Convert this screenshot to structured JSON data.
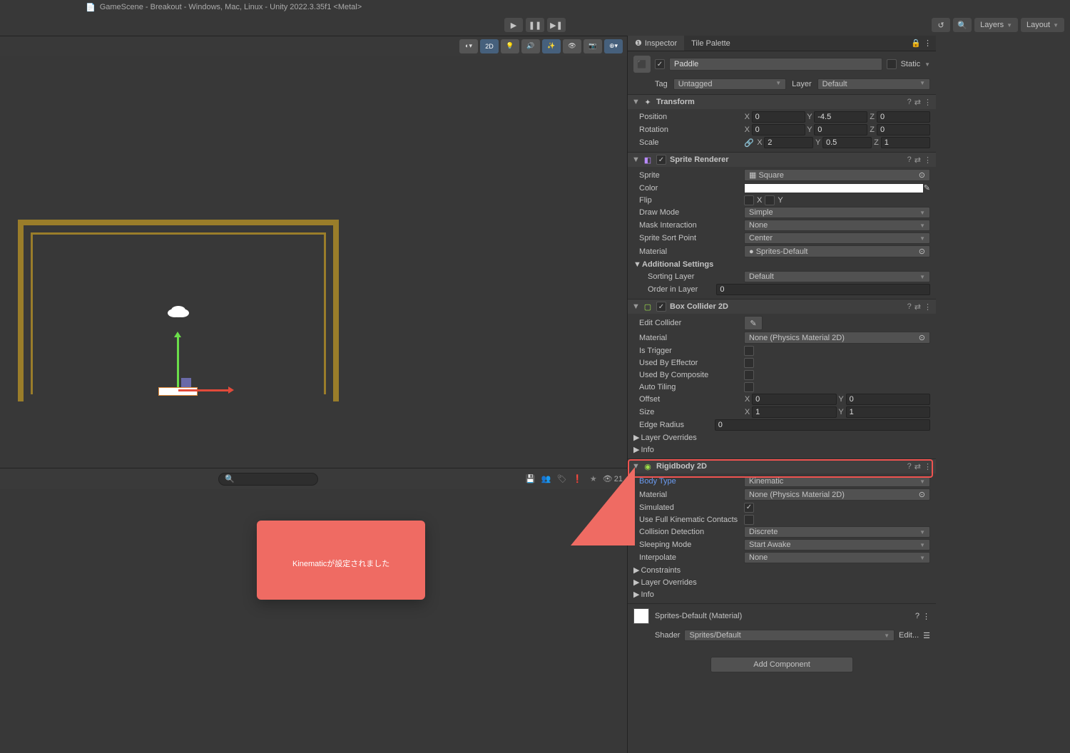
{
  "window_title": "GameScene - Breakout - Windows, Mac, Linux - Unity 2022.3.35f1 <Metal>",
  "toolbar": {
    "layers": "Layers",
    "layout": "Layout"
  },
  "tabs": {
    "inspector": "Inspector",
    "tile_palette": "Tile Palette"
  },
  "scene_tools": {
    "mode_2d": "2D"
  },
  "object": {
    "name": "Paddle",
    "static_label": "Static",
    "tag_label": "Tag",
    "tag_value": "Untagged",
    "layer_label": "Layer",
    "layer_value": "Default"
  },
  "transform": {
    "title": "Transform",
    "position_label": "Position",
    "rotation_label": "Rotation",
    "scale_label": "Scale",
    "position": {
      "x": "0",
      "y": "-4.5",
      "z": "0"
    },
    "rotation": {
      "x": "0",
      "y": "0",
      "z": "0"
    },
    "scale": {
      "x": "2",
      "y": "0.5",
      "z": "1"
    }
  },
  "sprite_renderer": {
    "title": "Sprite Renderer",
    "sprite_label": "Sprite",
    "sprite_value": "Square",
    "color_label": "Color",
    "flip_label": "Flip",
    "draw_mode_label": "Draw Mode",
    "draw_mode_value": "Simple",
    "mask_label": "Mask Interaction",
    "mask_value": "None",
    "sort_point_label": "Sprite Sort Point",
    "sort_point_value": "Center",
    "material_label": "Material",
    "material_value": "Sprites-Default",
    "additional_label": "Additional Settings",
    "sorting_layer_label": "Sorting Layer",
    "sorting_layer_value": "Default",
    "order_label": "Order in Layer",
    "order_value": "0"
  },
  "box_collider": {
    "title": "Box Collider 2D",
    "edit_label": "Edit Collider",
    "material_label": "Material",
    "material_value": "None (Physics Material 2D)",
    "is_trigger_label": "Is Trigger",
    "used_effector_label": "Used By Effector",
    "used_composite_label": "Used By Composite",
    "auto_tiling_label": "Auto Tiling",
    "offset_label": "Offset",
    "offset": {
      "x": "0",
      "y": "0"
    },
    "size_label": "Size",
    "size": {
      "x": "1",
      "y": "1"
    },
    "edge_radius_label": "Edge Radius",
    "edge_radius_value": "0",
    "layer_overrides_label": "Layer Overrides",
    "info_label": "Info"
  },
  "rigidbody": {
    "title": "Rigidbody 2D",
    "body_type_label": "Body Type",
    "body_type_value": "Kinematic",
    "material_label": "Material",
    "material_value": "None (Physics Material 2D)",
    "simulated_label": "Simulated",
    "kinematic_contacts_label": "Use Full Kinematic Contacts",
    "collision_label": "Collision Detection",
    "collision_value": "Discrete",
    "sleeping_label": "Sleeping Mode",
    "sleeping_value": "Start Awake",
    "interpolate_label": "Interpolate",
    "interpolate_value": "None",
    "constraints_label": "Constraints",
    "layer_overrides_label": "Layer Overrides",
    "info_label": "Info"
  },
  "material": {
    "name": "Sprites-Default (Material)",
    "shader_label": "Shader",
    "shader_value": "Sprites/Default",
    "edit_label": "Edit..."
  },
  "add_component": "Add Component",
  "console": {
    "count": "21"
  },
  "callout": {
    "text": "Kinematicが設定されました"
  }
}
